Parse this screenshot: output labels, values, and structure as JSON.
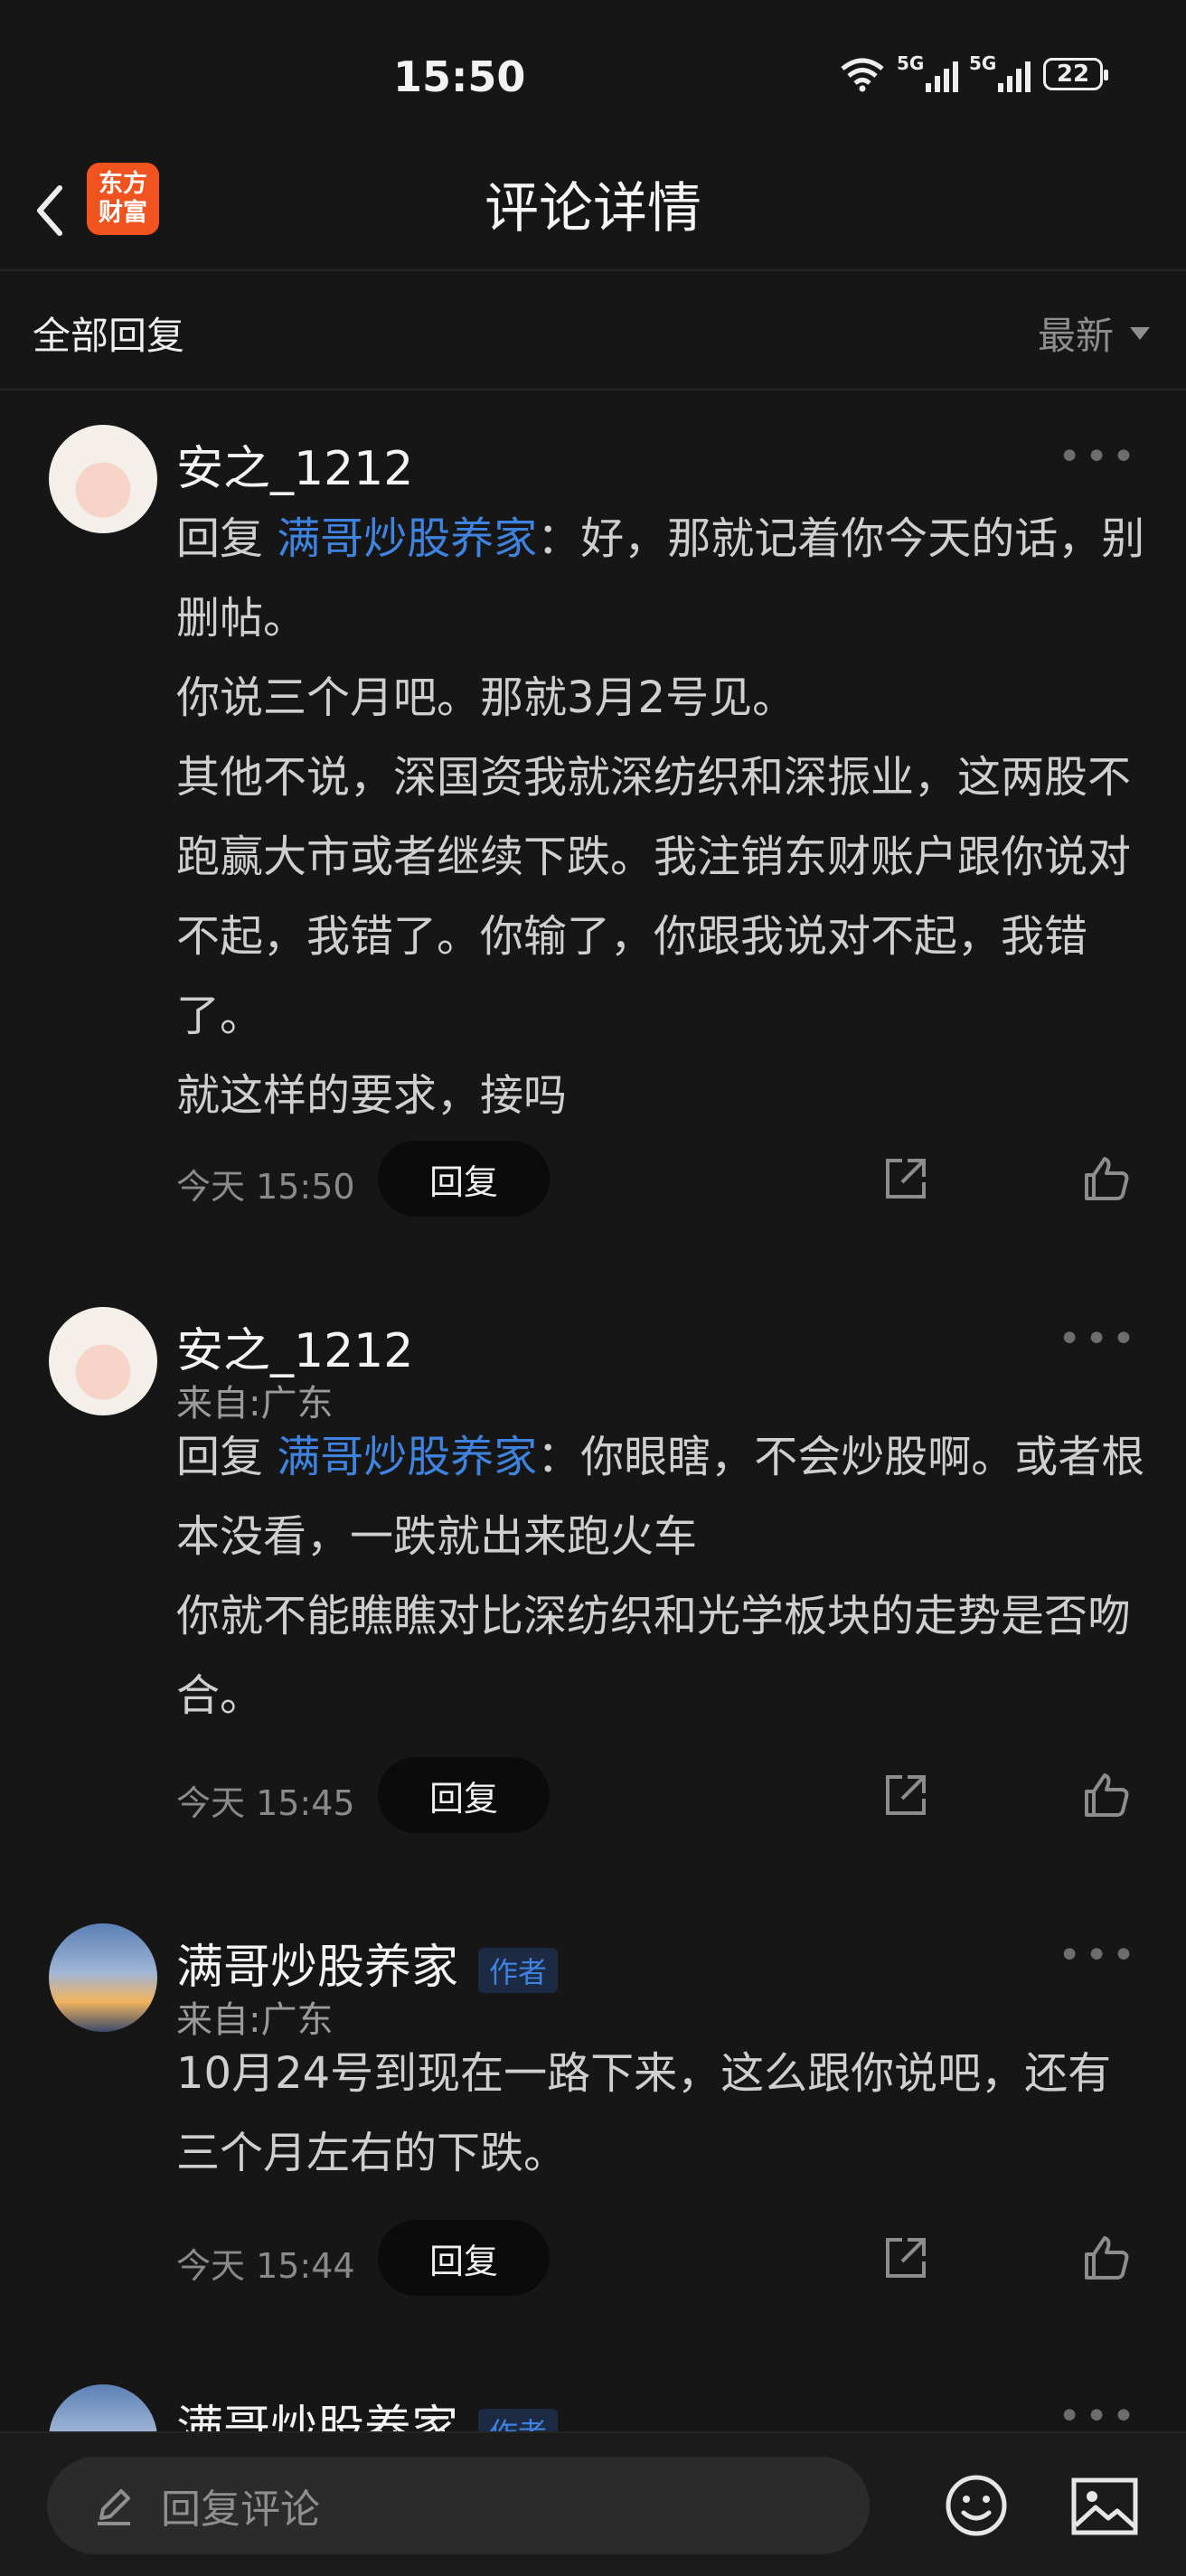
{
  "status_bar": {
    "time": "15:50",
    "net1": "5G",
    "net2": "5G",
    "battery": "22"
  },
  "nav": {
    "title": "评论详情",
    "logo_line1": "东方",
    "logo_line2": "财富"
  },
  "filter": {
    "label": "全部回复",
    "sort": "最新"
  },
  "comments": [
    {
      "user": "安之_1212",
      "location": "",
      "reply_prefix": "回复 ",
      "mention": "满哥炒股养家",
      "text_first": "：好，那就记着你今天的话，别删帖。",
      "text_rest": [
        "你说三个月吧。那就3月2号见。",
        "其他不说，深国资我就深纺织和深振业，这两股不跑赢大市或者继续下跌。我注销东财账户跟你说对不起，我错了。你输了，你跟我说对不起，我错了。",
        "就这样的要求，接吗"
      ],
      "time": "今天 15:50",
      "reply_label": "回复"
    },
    {
      "user": "安之_1212",
      "location": "来自:广东",
      "reply_prefix": "回复 ",
      "mention": "满哥炒股养家",
      "text_first": "：你眼瞎，不会炒股啊。或者根本没看，一跌就出来跑火车",
      "text_rest": [
        "你就不能瞧瞧对比深纺织和光学板块的走势是否吻合。"
      ],
      "time": "今天 15:45",
      "reply_label": "回复"
    },
    {
      "user": "满哥炒股养家",
      "author_tag": "作者",
      "location": "来自:广东",
      "text": "10月24号到现在一路下来，这么跟你说吧，还有三个月左右的下跌。",
      "time": "今天 15:44",
      "reply_label": "回复"
    },
    {
      "user": "满哥炒股养家",
      "author_tag": "作者"
    }
  ],
  "bottom": {
    "placeholder": "回复评论"
  },
  "icons": [
    "back-icon",
    "wifi-icon",
    "signal-icon",
    "battery-icon",
    "more-icon",
    "share-icon",
    "like-icon",
    "edit-icon",
    "emoji-icon",
    "image-icon"
  ]
}
